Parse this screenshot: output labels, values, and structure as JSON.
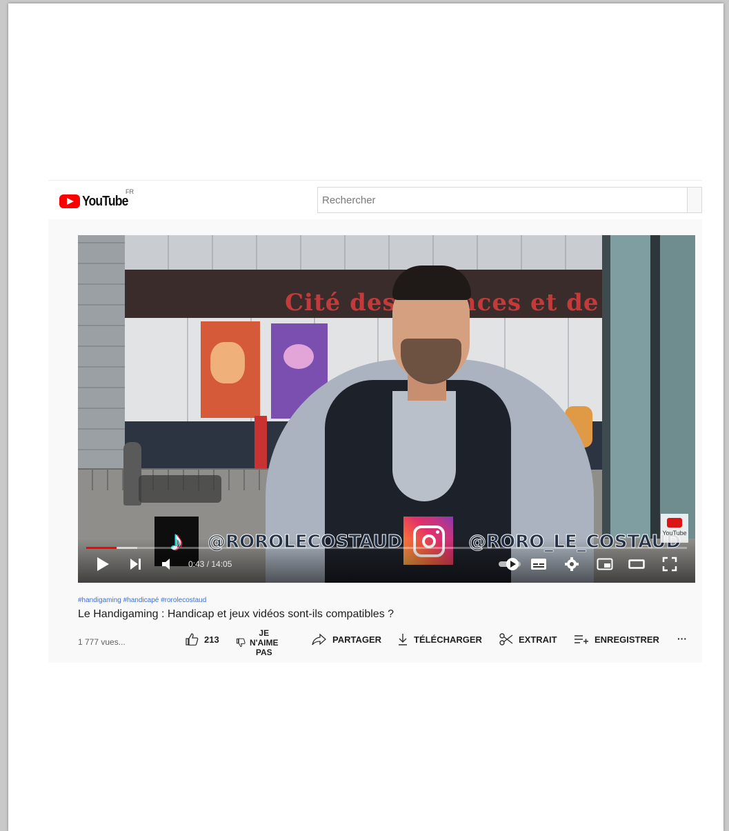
{
  "header": {
    "logo_text": "YouTube",
    "region": "FR",
    "search_placeholder": "Rechercher"
  },
  "player": {
    "overlay": {
      "tiktok_handle": "@ROROLECOSTAUD",
      "instagram_handle": "@RORO_LE_COSTAUD",
      "watermark": "YouTube"
    },
    "current_time": "0:43",
    "duration": "14:05",
    "time_display": "0:43 / 14:05",
    "progress_fraction": 0.051,
    "loaded_fraction": 0.085
  },
  "video": {
    "hashtags": "#handigaming #handicapé #rorolecostaud",
    "title": "Le Handigaming : Handicap et jeux vidéos sont-ils compatibles ?",
    "views": "1 777 vues..."
  },
  "actions": {
    "like_count": "213",
    "dislike_label": "JE\nN'AIME\nPAS",
    "share": "PARTAGER",
    "download": "TÉLÉCHARGER",
    "clip": "EXTRAIT",
    "save": "ENREGISTRER",
    "more": "···"
  },
  "colors": {
    "brand_red": "#ff0000",
    "hashtag_blue": "#3e6fd0"
  }
}
